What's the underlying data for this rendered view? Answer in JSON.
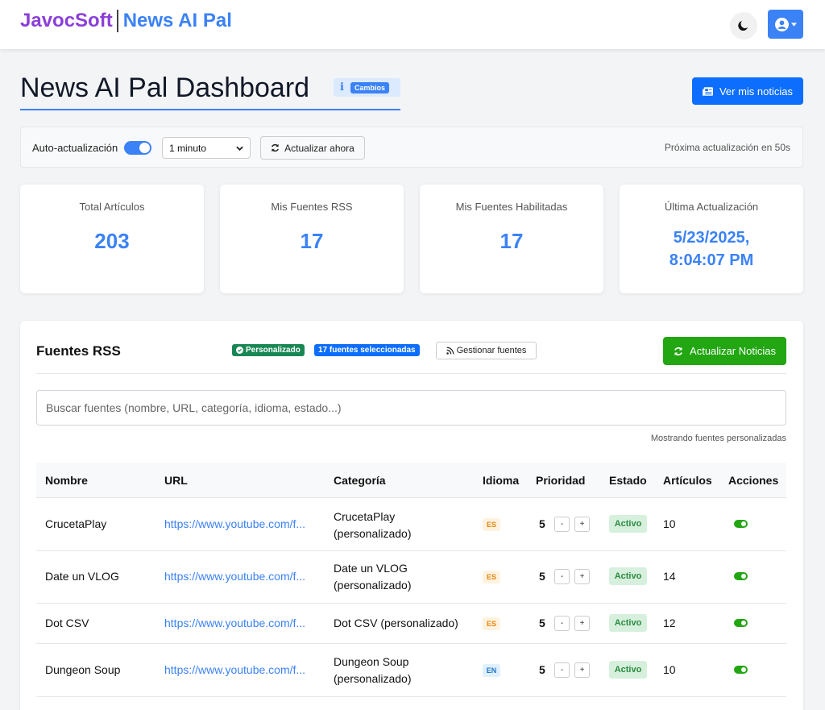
{
  "nav": {
    "brand_primary": "JavocSoft",
    "brand_secondary": "News AI Pal",
    "theme_icon": "moon-icon",
    "user_icon": "user-circle-icon"
  },
  "header": {
    "title": "News AI Pal Dashboard",
    "info_badge": "Cambios",
    "view_news_label": "Ver mis noticias"
  },
  "refresh": {
    "auto_label": "Auto-actualización",
    "interval": "1 minuto",
    "refresh_now_label": "Actualizar ahora",
    "next_update": "Próxima actualización en 50s"
  },
  "stats": [
    {
      "label": "Total Artículos",
      "value": "203"
    },
    {
      "label": "Mis Fuentes RSS",
      "value": "17"
    },
    {
      "label": "Mis Fuentes Habilitadas",
      "value": "17"
    },
    {
      "label": "Última Actualización",
      "value_line1": "5/23/2025,",
      "value_line2": "8:04:07 PM"
    }
  ],
  "rss": {
    "title": "Fuentes RSS",
    "badge_custom": "Personalizado",
    "badge_selected": "17 fuentes seleccionadas",
    "manage_label": "Gestionar fuentes",
    "update_label": "Actualizar Noticias",
    "search_placeholder": "Buscar fuentes (nombre, URL, categoría, idioma, estado...)",
    "showing_note": "Mostrando fuentes personalizadas",
    "columns": [
      "Nombre",
      "URL",
      "Categoría",
      "Idioma",
      "Prioridad",
      "Estado",
      "Artículos",
      "Acciones"
    ],
    "rows": [
      {
        "name": "CrucetaPlay",
        "url": "https://www.youtube.com/f...",
        "category_line1": "CrucetaPlay",
        "category_line2": "(personalizado)",
        "lang": "ES",
        "priority": "5",
        "status": "Activo",
        "articles": "10"
      },
      {
        "name": "Date un VLOG",
        "url": "https://www.youtube.com/f...",
        "category_line1": "Date un VLOG",
        "category_line2": "(personalizado)",
        "lang": "ES",
        "priority": "5",
        "status": "Activo",
        "articles": "14"
      },
      {
        "name": "Dot CSV",
        "url": "https://www.youtube.com/f...",
        "category_line1": "Dot CSV (personalizado)",
        "category_line2": "",
        "lang": "ES",
        "priority": "5",
        "status": "Activo",
        "articles": "12"
      },
      {
        "name": "Dungeon Soup",
        "url": "https://www.youtube.com/f...",
        "category_line1": "Dungeon Soup",
        "category_line2": "(personalizado)",
        "lang": "EN",
        "priority": "5",
        "status": "Activo",
        "articles": "10"
      }
    ],
    "stepper_minus": "-",
    "stepper_plus": "+"
  }
}
